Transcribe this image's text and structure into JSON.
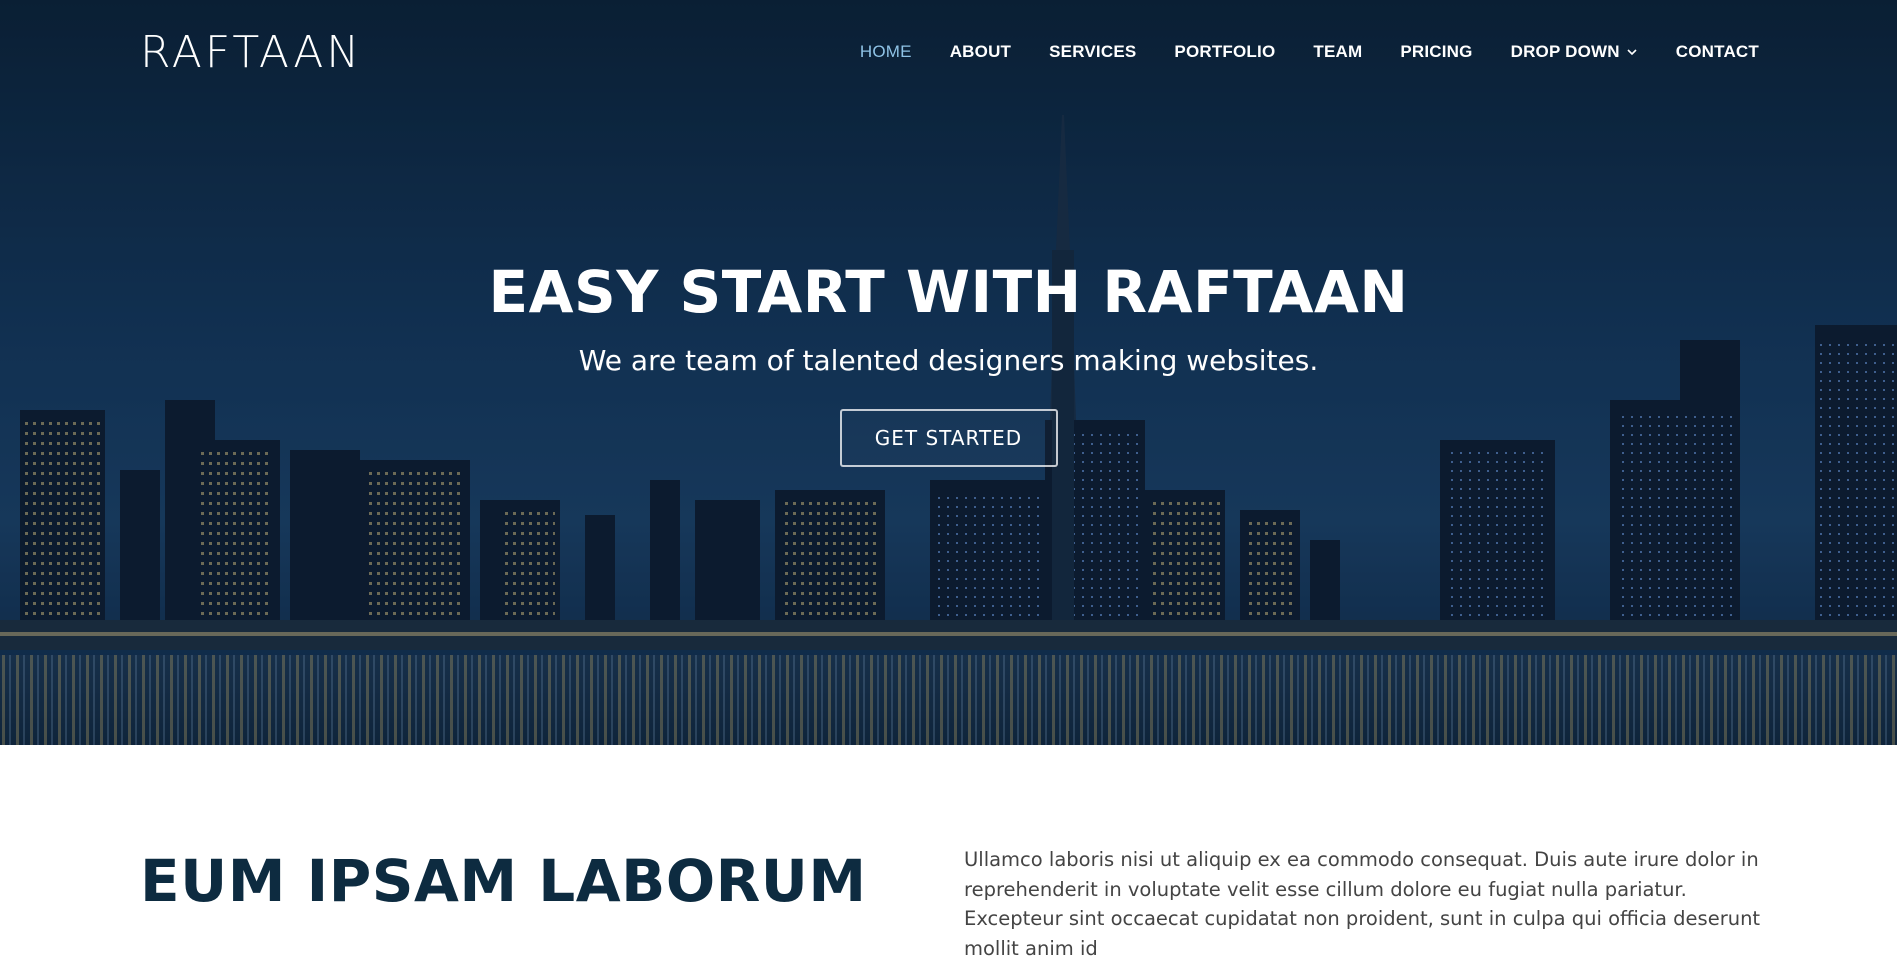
{
  "header": {
    "logo": "RAFTAAN",
    "nav": [
      {
        "label": "HOME",
        "active": true
      },
      {
        "label": "ABOUT",
        "active": false
      },
      {
        "label": "SERVICES",
        "active": false
      },
      {
        "label": "PORTFOLIO",
        "active": false
      },
      {
        "label": "TEAM",
        "active": false
      },
      {
        "label": "PRICING",
        "active": false
      },
      {
        "label": "DROP DOWN",
        "active": false,
        "dropdown": true
      },
      {
        "label": "CONTACT",
        "active": false
      }
    ]
  },
  "hero": {
    "title": "EASY START WITH RAFTAAN",
    "subtitle": "We are team of talented designers making websites.",
    "cta_label": "GET STARTED",
    "background": "night-city-skyline-photo"
  },
  "about": {
    "title": "EUM IPSAM LABORUM",
    "text": "Ullamco laboris nisi ut aliquip ex ea commodo consequat. Duis aute irure dolor in reprehenderit in voluptate velit esse cillum dolore eu fugiat nulla pariatur. Excepteur sint occaecat cupidatat non proident, sunt in culpa qui officia deserunt mollit anim id"
  },
  "colors": {
    "active_nav": "#8fc3e6",
    "heading": "#0d2b40",
    "body_text": "#444444",
    "hero_bg": "#0f2e4d"
  }
}
